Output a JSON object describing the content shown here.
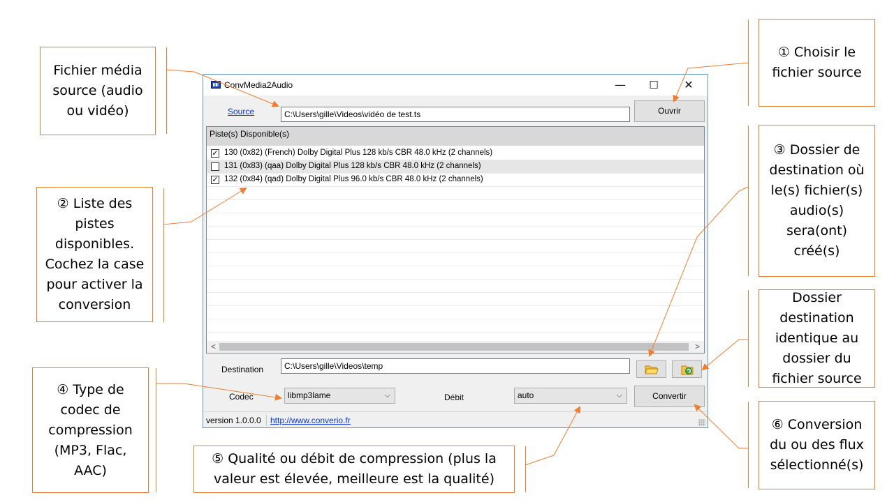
{
  "window": {
    "title": "ConvMedia2Audio",
    "controls": {
      "minimize": "—",
      "maximize": "☐",
      "close": "✕"
    }
  },
  "source": {
    "label": "Source",
    "path": "C:\\Users\\gille\\Videos\\vidéo de test.ts",
    "open_button": "Ouvrir"
  },
  "tracks": {
    "header": "Piste(s) Disponible(s)",
    "items": [
      {
        "checked": true,
        "label": "130 (0x82) (French) Dolby Digital Plus 128 kb/s CBR 48.0 kHz (2 channels)"
      },
      {
        "checked": false,
        "label": "131 (0x83) (qaa) Dolby Digital Plus 128 kb/s CBR 48.0 kHz (2 channels)"
      },
      {
        "checked": true,
        "label": "132 (0x84) (qad) Dolby Digital Plus 96.0 kb/s CBR 48.0 kHz (2 channels)"
      }
    ]
  },
  "destination": {
    "label": "Destination",
    "path": "C:\\Users\\gille\\Videos\\temp",
    "browse_icon": "folder-icon",
    "same_folder_icon": "refresh-folder-icon"
  },
  "codec": {
    "label": "Codec",
    "value": "libmp3lame"
  },
  "bitrate": {
    "label": "Débit",
    "value": "auto"
  },
  "convert_button": "Convertir",
  "statusbar": {
    "version": "version 1.0.0.0",
    "link": "http://www.converio.fr"
  },
  "callouts": {
    "c_source": "Fichier média source (audio ou vidéo)",
    "c1": "① Choisir le fichier source",
    "c2": "② Liste des pistes disponibles. Cochez la case pour activer la conversion",
    "c3": "③ Dossier de destination où le(s) fichier(s) audio(s) sera(ont) créé(s)",
    "c_same": "Dossier destination identique au dossier du fichier source",
    "c4": "④ Type de codec de compression (MP3, Flac, AAC)",
    "c5": "⑤ Qualité ou débit de compression (plus la valeur est élevée, meilleure est la qualité)",
    "c6": "⑥ Conversion du ou des flux sélectionné(s)"
  },
  "colors": {
    "callout_border": "#ED7D31",
    "window_border": "#5B9BD5",
    "link": "#0B36D6"
  }
}
